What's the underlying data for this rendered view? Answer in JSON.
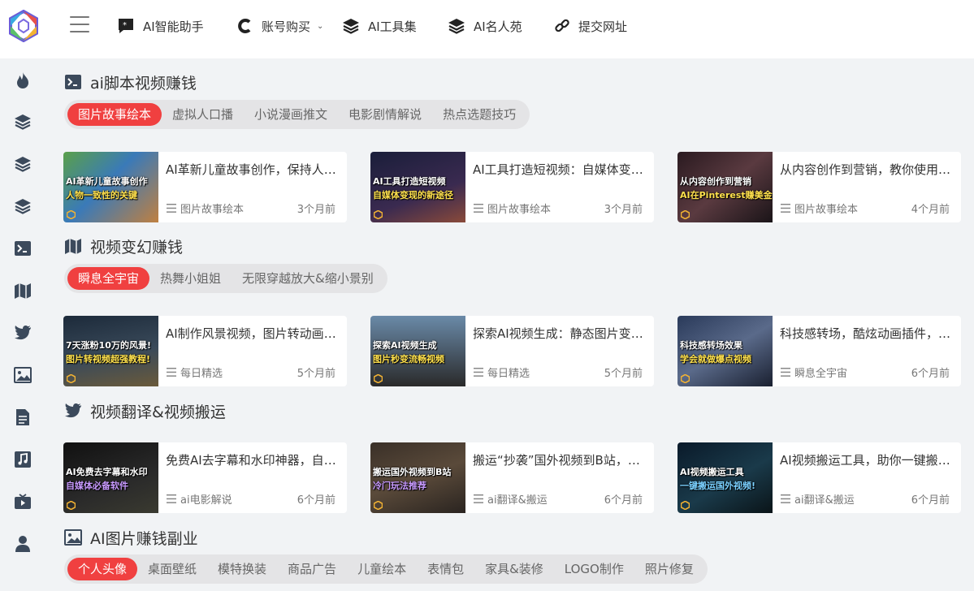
{
  "nav": {
    "items": [
      {
        "label": "AI智能助手",
        "icon": "chat-star-icon"
      },
      {
        "label": "账号购买",
        "icon": "c-logo-icon",
        "dropdown": true
      },
      {
        "label": "AI工具集",
        "icon": "layers-icon"
      },
      {
        "label": "AI名人苑",
        "icon": "layers-icon"
      },
      {
        "label": "提交网址",
        "icon": "link-icon"
      }
    ]
  },
  "sidebar": {
    "icons": [
      "fire-icon",
      "layers-icon",
      "layers-icon",
      "layers-icon",
      "terminal-icon",
      "map-icon",
      "twitter-icon",
      "image-icon",
      "document-icon",
      "music-icon",
      "tv-icon",
      "user-icon"
    ]
  },
  "sections": [
    {
      "title": "ai脚本视频赚钱",
      "icon": "terminal-icon",
      "tabs": [
        "图片故事绘本",
        "虚拟人口播",
        "小说漫画推文",
        "电影剧情解说",
        "热点选题技巧"
      ],
      "cards": [
        {
          "title": "AI革新儿童故事创作，保持人物一致性的关键",
          "category": "图片故事绘本",
          "time": "3个月前",
          "thumb_line1": "AI革新儿童故事创作",
          "thumb_line2": "人物一致性的关键"
        },
        {
          "title": "AI工具打造短视频：自媒体变现的新途径",
          "category": "图片故事绘本",
          "time": "3个月前",
          "thumb_line1": "AI工具打造短视频",
          "thumb_line2": "自媒体变现的新途径"
        },
        {
          "title": "从内容创作到营销，教你使用AI在Pinterest赚美金",
          "category": "图片故事绘本",
          "time": "4个月前",
          "thumb_line1": "从内容创作到营销",
          "thumb_line2": "AI在Pinterest赚美金"
        }
      ]
    },
    {
      "title": "视频变幻赚钱",
      "icon": "map-icon",
      "tabs": [
        "瞬息全宇宙",
        "热舞小姐姐",
        "无限穿越放大&缩小景别"
      ],
      "cards": [
        {
          "title": "AI制作风景视频，图片转动画超强教程",
          "category": "每日精选",
          "time": "5个月前",
          "thumb_line1": "7天涨粉10万的风景!",
          "thumb_line2": "图片转视频超强教程!"
        },
        {
          "title": "探索AI视频生成：静态图片变流畅视频",
          "category": "每日精选",
          "time": "5个月前",
          "thumb_line1": "探索AI视频生成",
          "thumb_line2": "图片秒变流畅视频"
        },
        {
          "title": "科技感转场，酷炫动画插件，学会就做爆点视频",
          "category": "瞬息全宇宙",
          "time": "6个月前",
          "thumb_line1": "科技感转场效果",
          "thumb_line2": "学会就做爆点视频"
        }
      ]
    },
    {
      "title": "视频翻译&视频搬运",
      "icon": "twitter-icon",
      "tabs": [],
      "cards": [
        {
          "title": "免费AI去字幕和水印神器，自媒体必备软件",
          "category": "ai电影解说",
          "time": "6个月前",
          "thumb_line1": "AI免费去字幕和水印",
          "thumb_line2": "自媒体必备软件"
        },
        {
          "title": "搬运“抄袭”国外视频到B站，冷门玩法推荐",
          "category": "ai翻译&搬运",
          "time": "6个月前",
          "thumb_line1": "搬运国外视频到B站",
          "thumb_line2": "冷门玩法推荐"
        },
        {
          "title": "AI视频搬运工具，助你一键搬运国外视频",
          "category": "ai翻译&搬运",
          "time": "6个月前",
          "thumb_line1": "AI视频搬运工具",
          "thumb_line2": "一键搬运国外视频!"
        }
      ]
    },
    {
      "title": "AI图片赚钱副业",
      "icon": "image-icon",
      "tabs": [
        "个人头像",
        "桌面壁纸",
        "模特换装",
        "商品广告",
        "儿童绘本",
        "表情包",
        "家具&装修",
        "LOGO制作",
        "照片修复"
      ],
      "cards": []
    }
  ],
  "colors": {
    "accent": "#f04040",
    "tab_bg": "#e4e4e6",
    "page_bg": "#f1f3f5"
  }
}
